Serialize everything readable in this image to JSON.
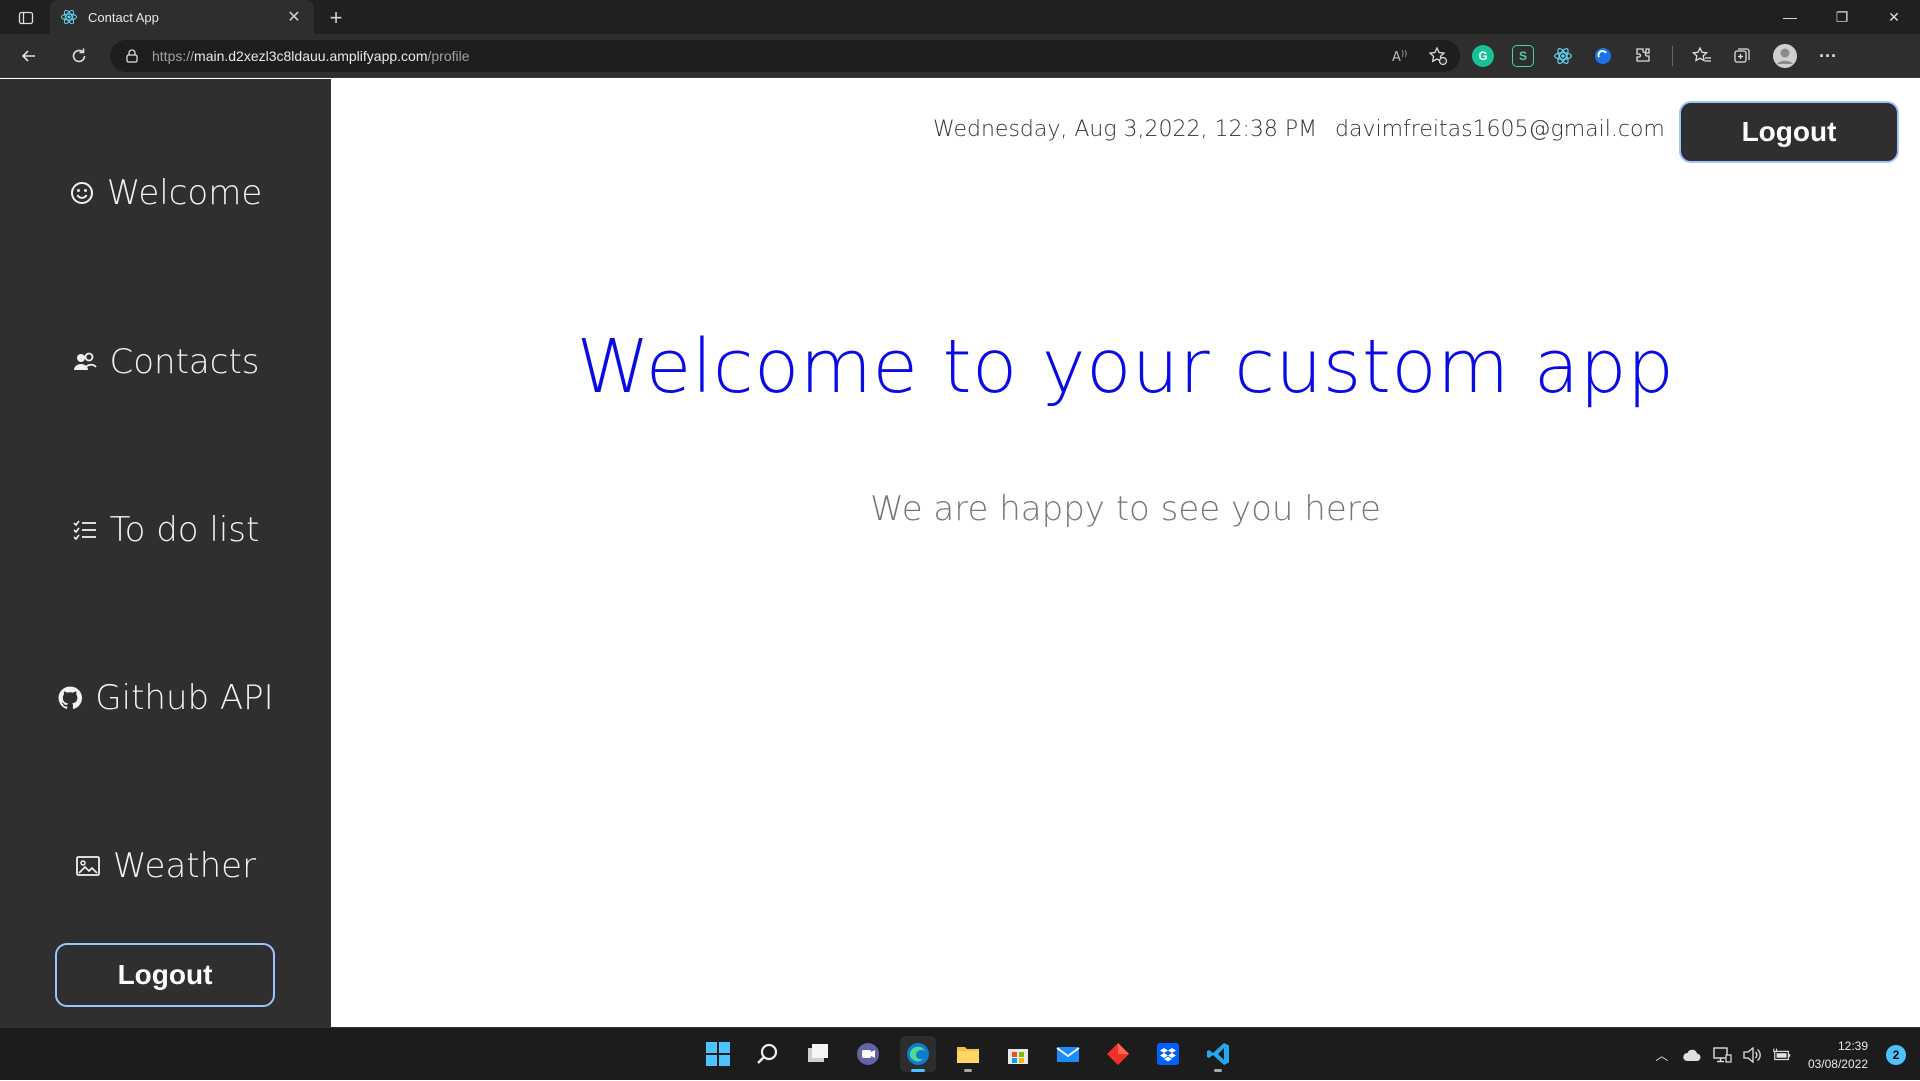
{
  "browser": {
    "tab_title": "Contact App",
    "url_scheme": "https://",
    "url_host": "main.d2xezl3c8ldauu.amplifyapp.com",
    "url_path": "/profile",
    "extensions": [
      "G",
      "S"
    ]
  },
  "sidebar": {
    "items": [
      {
        "label": "Welcome",
        "icon": "smiley-icon"
      },
      {
        "label": "Contacts",
        "icon": "contacts-icon"
      },
      {
        "label": "To do list",
        "icon": "checklist-icon"
      },
      {
        "label": "Github API",
        "icon": "github-icon"
      },
      {
        "label": "Weather",
        "icon": "image-icon"
      }
    ],
    "logout_label": "Logout"
  },
  "header": {
    "datetime": "Wednesday, Aug 3,2022, 12:38 PM",
    "email": "davimfreitas1605@gmail.com",
    "logout_label": "Logout"
  },
  "main": {
    "title": "Welcome to your custom app",
    "subtitle": "We are happy to see you here"
  },
  "taskbar": {
    "time": "12:39",
    "date": "03/08/2022",
    "notification_count": "2"
  },
  "colors": {
    "sidebar_bg": "#2f2f2f",
    "title_blue": "#0a0ae6",
    "button_border": "#9ec3ff"
  }
}
